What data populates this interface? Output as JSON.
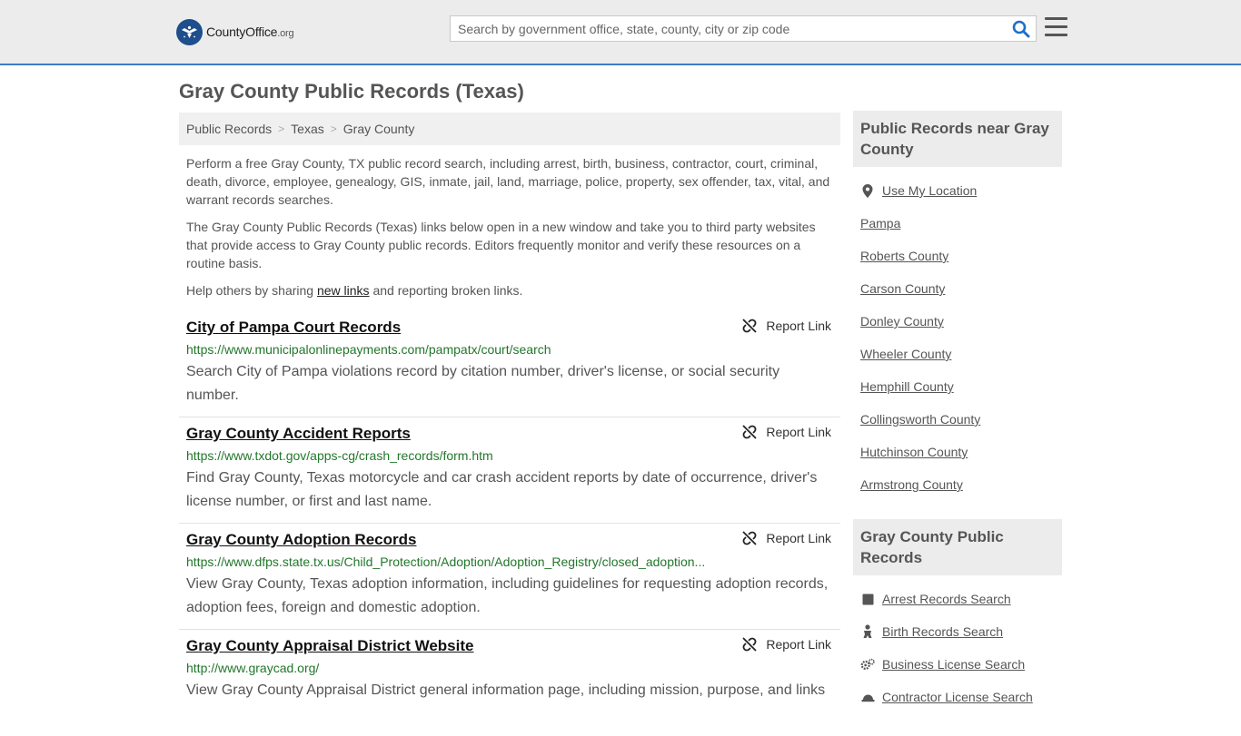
{
  "header": {
    "logo_main": "CountyOffice",
    "logo_suffix": ".org",
    "search_placeholder": "Search by government office, state, county, city or zip code"
  },
  "page_title": "Gray County Public Records (Texas)",
  "breadcrumb": [
    "Public Records",
    "Texas",
    "Gray County"
  ],
  "intro": {
    "p1": "Perform a free Gray County, TX public record search, including arrest, birth, business, contractor, court, criminal, death, divorce, employee, genealogy, GIS, inmate, jail, land, marriage, police, property, sex offender, tax, vital, and warrant records searches.",
    "p2": "The Gray County Public Records (Texas) links below open in a new window and take you to third party websites that provide access to Gray County public records. Editors frequently monitor and verify these resources on a routine basis.",
    "p3_before": "Help others by sharing ",
    "p3_link": "new links",
    "p3_after": " and reporting broken links."
  },
  "report_label": "Report Link",
  "records": [
    {
      "title": "City of Pampa Court Records",
      "url": "https://www.municipalonlinepayments.com/pampatx/court/search",
      "desc": "Search City of Pampa violations record by citation number, driver's license, or social security number."
    },
    {
      "title": "Gray County Accident Reports",
      "url": "https://www.txdot.gov/apps-cg/crash_records/form.htm",
      "desc": "Find Gray County, Texas motorcycle and car crash accident reports by date of occurrence, driver's license number, or first and last name."
    },
    {
      "title": "Gray County Adoption Records",
      "url": "https://www.dfps.state.tx.us/Child_Protection/Adoption/Adoption_Registry/closed_adoption...",
      "desc": "View Gray County, Texas adoption information, including guidelines for requesting adoption records, adoption fees, foreign and domestic adoption."
    },
    {
      "title": "Gray County Appraisal District Website",
      "url": "http://www.graycad.org/",
      "desc": "View Gray County Appraisal District general information page, including mission, purpose, and links"
    }
  ],
  "sidebar": {
    "near_heading": "Public Records near Gray County",
    "use_location": "Use My Location",
    "near_links": [
      "Pampa",
      "Roberts County",
      "Carson County",
      "Donley County",
      "Wheeler County",
      "Hemphill County",
      "Collingsworth County",
      "Hutchinson County",
      "Armstrong County"
    ],
    "records_heading": "Gray County Public Records",
    "record_links": [
      {
        "label": "Arrest Records Search",
        "icon": "square-icon"
      },
      {
        "label": "Birth Records Search",
        "icon": "baby-icon"
      },
      {
        "label": "Business License Search",
        "icon": "gears-icon"
      },
      {
        "label": "Contractor License Search",
        "icon": "hardhat-icon"
      }
    ]
  },
  "colors": {
    "accent": "#3f7bc7",
    "link_green": "#22772b",
    "logo_blue": "#1e4e8c"
  }
}
